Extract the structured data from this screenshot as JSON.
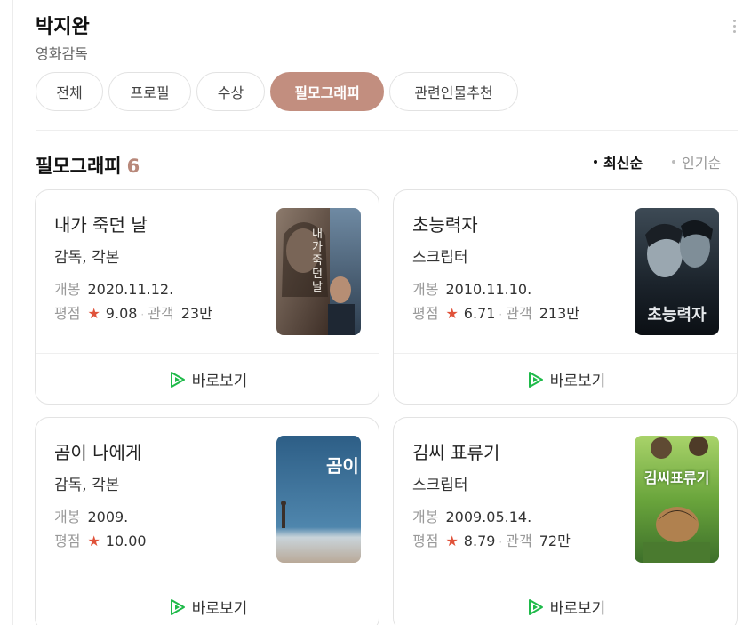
{
  "person": {
    "name": "박지완",
    "role": "영화감독"
  },
  "tabs": [
    {
      "label": "전체"
    },
    {
      "label": "프로필"
    },
    {
      "label": "수상"
    },
    {
      "label": "필모그래피"
    },
    {
      "label": "관련인물추천"
    }
  ],
  "active_tab": "필모그래피",
  "section": {
    "title": "필모그래피",
    "count": "6"
  },
  "sort": {
    "latest": "최신순",
    "popular": "인기순",
    "selected": "최신순"
  },
  "labels": {
    "open": "개봉",
    "rating": "평점",
    "audience": "관객",
    "watch": "바로보기",
    "star": "★"
  },
  "colors": {
    "accent": "#c28e7f",
    "star": "#e0523a",
    "play": "#1fba4a"
  },
  "movies": [
    {
      "title": "내가 죽던 날",
      "role": "감독, 각본",
      "date": "2020.11.12.",
      "rating": "9.08",
      "audience": "23만",
      "poster_text": "내가 죽던 날"
    },
    {
      "title": "초능력자",
      "role": "스크립터",
      "date": "2010.11.10.",
      "rating": "6.71",
      "audience": "213만",
      "poster_text": "초능력자"
    },
    {
      "title": "곰이 나에게",
      "role": "감독, 각본",
      "date": "2009.",
      "rating": "10.00",
      "audience": "",
      "poster_text": "곰이"
    },
    {
      "title": "김씨 표류기",
      "role": "스크립터",
      "date": "2009.05.14.",
      "rating": "8.79",
      "audience": "72만",
      "poster_text": "김씨표류기"
    }
  ]
}
